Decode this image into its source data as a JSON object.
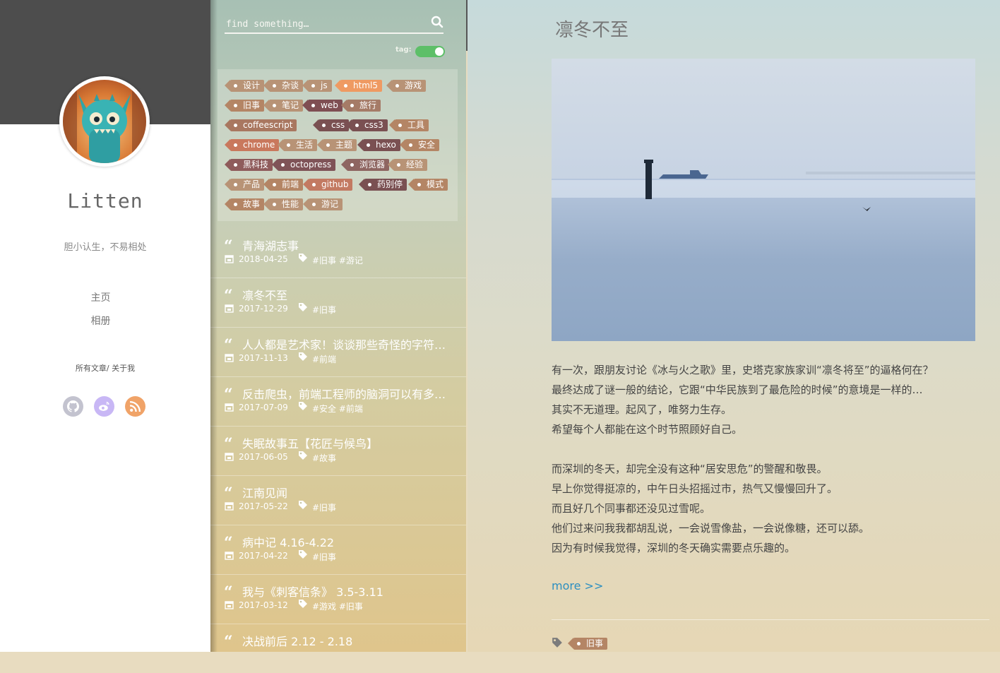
{
  "profile": {
    "name": "Litten",
    "motto": "胆小认生，不易相处",
    "nav": [
      "主页",
      "相册"
    ],
    "links": "所有文章/ 关于我",
    "social": [
      {
        "icon": "github-icon",
        "color": "#c3c3cf"
      },
      {
        "icon": "weibo-icon",
        "color": "#c8b7f5"
      },
      {
        "icon": "rss-icon",
        "color": "#f0a368"
      }
    ]
  },
  "search": {
    "placeholder": "find something…"
  },
  "tag_toggle": {
    "label": "tag:",
    "on": true
  },
  "tags": [
    {
      "label": "设计",
      "color": "#b89376"
    },
    {
      "label": "杂谈",
      "color": "#b89376"
    },
    {
      "label": "js",
      "color": "#b89376"
    },
    {
      "label": "html5",
      "color": "#ef9a62"
    },
    {
      "label": "游戏",
      "color": "#b89376"
    },
    {
      "label": "旧事",
      "color": "#b48565"
    },
    {
      "label": "笔记",
      "color": "#b89376"
    },
    {
      "label": "web",
      "color": "#7f4e53"
    },
    {
      "label": "旅行",
      "color": "#a57b67"
    },
    {
      "label": "coffeescript",
      "color": "#a97760"
    },
    {
      "label": "css",
      "color": "#7a5052"
    },
    {
      "label": "css3",
      "color": "#7a5052"
    },
    {
      "label": "工具",
      "color": "#b48565"
    },
    {
      "label": "chrome",
      "color": "#c9785d"
    },
    {
      "label": "生活",
      "color": "#b89376"
    },
    {
      "label": "主题",
      "color": "#b89376"
    },
    {
      "label": "hexo",
      "color": "#7a5052"
    },
    {
      "label": "安全",
      "color": "#b48565"
    },
    {
      "label": "黑科技",
      "color": "#8f5b5b"
    },
    {
      "label": "octopress",
      "color": "#7f5357"
    },
    {
      "label": "浏览器",
      "color": "#8e6561"
    },
    {
      "label": "经验",
      "color": "#b89376"
    },
    {
      "label": "产品",
      "color": "#b89376"
    },
    {
      "label": "前端",
      "color": "#b48565"
    },
    {
      "label": "github",
      "color": "#c37a62"
    },
    {
      "label": "药别停",
      "color": "#7a5052"
    },
    {
      "label": "模式",
      "color": "#b48565"
    },
    {
      "label": "故事",
      "color": "#b48565"
    },
    {
      "label": "性能",
      "color": "#b89376"
    },
    {
      "label": "游记",
      "color": "#b89376"
    }
  ],
  "posts": [
    {
      "title": "青海湖志事",
      "date": "2018-04-25",
      "tags": "#旧事 #游记"
    },
    {
      "title": "凛冬不至",
      "date": "2017-12-29",
      "tags": "#旧事"
    },
    {
      "title": "人人都是艺术家！谈谈那些奇怪的字符…",
      "date": "2017-11-13",
      "tags": "#前端"
    },
    {
      "title": "反击爬虫，前端工程师的脑洞可以有多…",
      "date": "2017-07-09",
      "tags": "#安全 #前端"
    },
    {
      "title": "失眠故事五【花匠与候鸟】",
      "date": "2017-06-05",
      "tags": "#故事"
    },
    {
      "title": "江南见闻",
      "date": "2017-05-22",
      "tags": "#旧事"
    },
    {
      "title": "病中记 4.16-4.22",
      "date": "2017-04-22",
      "tags": "#旧事"
    },
    {
      "title": "我与《刺客信条》 3.5-3.11",
      "date": "2017-03-12",
      "tags": "#游戏 #旧事"
    },
    {
      "title": "决战前后 2.12 - 2.18",
      "date": "",
      "tags": ""
    }
  ],
  "article": {
    "title": "凛冬不至",
    "paragraph1": [
      "有一次，跟朋友讨论《冰与火之歌》里，史塔克家族家训“凛冬将至”的逼格何在？",
      "最终达成了谜一般的结论，它跟“中华民族到了最危险的时候”的意境是一样的…",
      "其实不无道理。起风了，唯努力生存。",
      "希望每个人都能在这个时节照顾好自己。"
    ],
    "paragraph2": [
      "而深圳的冬天，却完全没有这种“居安思危”的警醒和敬畏。",
      "早上你觉得挺凉的，中午日头招摇过市，热气又慢慢回升了。",
      "而且好几个同事都还没见过雪呢。",
      "他们过来问我我都胡乱说，一会说雪像盐，一会说像糖，还可以舔。",
      "因为有时候我觉得，深圳的冬天确实需要点乐趣的。"
    ],
    "more": "more >>",
    "tags": [
      "旧事"
    ]
  }
}
